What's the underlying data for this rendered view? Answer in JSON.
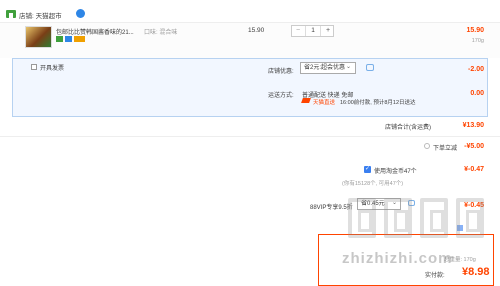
{
  "shop": {
    "label": "店铺: 天猫超市"
  },
  "item": {
    "title": "包邮比比赞韩国酱香味的21...",
    "spec": "口味: 混合味",
    "unit_price": "15.90",
    "quantity": "1",
    "qty_minus": "−",
    "qty_plus": "+",
    "subtotal": "15.90",
    "weight": "170g"
  },
  "options": {
    "invoice_label": "开具发票",
    "promo_label": "店铺优惠:",
    "promo_selected": "省2元:超会优惠",
    "promo_amount": "-2.00",
    "shipping_label": "运送方式:",
    "shipping_methods": "普通配送 快递 免邮",
    "shipping_brand": "天猫直送",
    "shipping_eta": "16:00前付款, 预计8月12日送达",
    "shipping_fee": "0.00"
  },
  "shop_total": {
    "label": "店铺合计(含运费)",
    "value": "¥13.90"
  },
  "instant_discount": {
    "label": "下单立减",
    "value": "-¥5.00"
  },
  "coins": {
    "label": "使用淘金币47个",
    "value": "¥-0.47",
    "note": "(你有15128个, 可用47个)"
  },
  "vip": {
    "label": "88VIP专享9.5折",
    "selected": "省0.45元",
    "value": "¥-0.45"
  },
  "summary": {
    "weight": "总重量: 170g",
    "paid_label": "实付款:",
    "paid_value": "¥8.98"
  },
  "watermark": {
    "text": "zhizhizhi.com"
  },
  "colors": {
    "accent": "#ff4400",
    "link": "#3a7ff0",
    "panel": "#f2f7ff"
  },
  "icons": [
    "shop-icon",
    "chevron-down-icon",
    "info-icon",
    "check-icon"
  ]
}
